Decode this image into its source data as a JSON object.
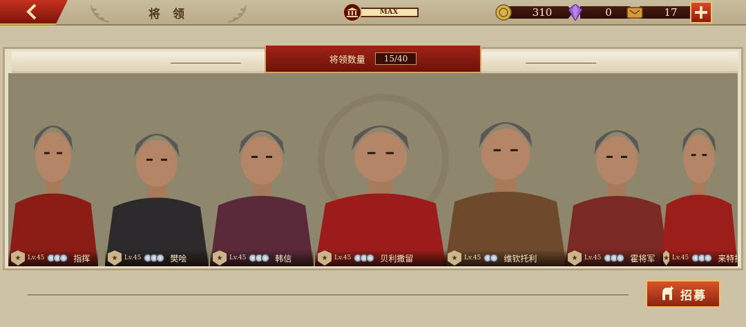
{
  "header": {
    "title": "将 领",
    "capacity_label": "MAX",
    "resources": [
      {
        "name": "gold",
        "value": "310",
        "icon": "gold-coin-icon",
        "color": "#d7b24a"
      },
      {
        "name": "gem",
        "value": "0",
        "icon": "purple-gem-icon",
        "color": "#9b5fd8"
      },
      {
        "name": "ticket",
        "value": "17",
        "icon": "recruit-ticket-icon",
        "color": "#d79a3a"
      }
    ],
    "plus_label": "+"
  },
  "panel": {
    "count_label": "将领数量",
    "count_value": "15/40"
  },
  "heroes": [
    {
      "name": "指挥",
      "level": "Lv.45",
      "stars": 3,
      "portrait": "roman-centurion-portrait",
      "cape": "#8c1d16"
    },
    {
      "name": "樊哙",
      "level": "Lv.45",
      "stars": 3,
      "portrait": "chinese-warrior-portrait",
      "cape": "#2c2a2c"
    },
    {
      "name": "韩信",
      "level": "Lv.45",
      "stars": 3,
      "portrait": "helmeted-general-portrait",
      "cape": "#5a2a3a"
    },
    {
      "name": "贝利撒留",
      "level": "Lv.45",
      "stars": 3,
      "portrait": "byzantine-general-portrait",
      "cape": "#9b1c1a"
    },
    {
      "name": "维钦托利",
      "level": "Lv.45",
      "stars": 2,
      "portrait": "gaul-chieftain-portrait",
      "cape": "#6e4a2c"
    },
    {
      "name": "霍将军",
      "level": "Lv.45",
      "stars": 3,
      "portrait": "han-general-portrait",
      "cape": "#7a2a22"
    },
    {
      "name": "来特拉达梯",
      "level": "Lv.45",
      "stars": 3,
      "portrait": "lion-pelt-warrior-portrait",
      "cape": "#9c1e18"
    }
  ],
  "actions": {
    "recruit_label": "招募"
  }
}
